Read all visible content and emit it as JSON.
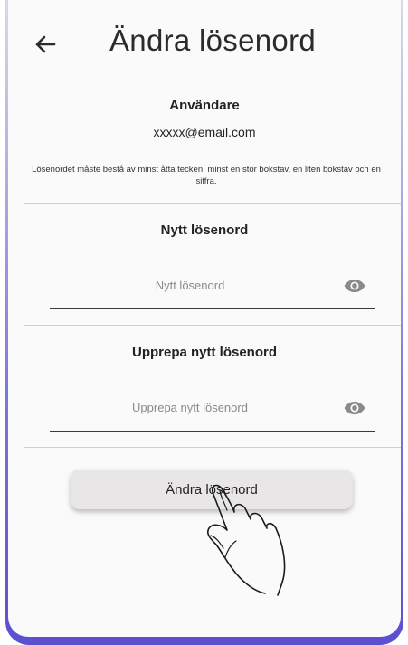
{
  "header": {
    "back_icon": "arrow-left-icon",
    "title": "Ändra lösenord"
  },
  "user": {
    "label": "Användare",
    "email": "xxxxx@email.com"
  },
  "requirements_text": "Lösenordet måste bestå av minst åtta tecken, minst en stor bokstav, en liten bokstav och en siffra.",
  "new_password": {
    "label": "Nytt lösenord",
    "placeholder": "Nytt lösenord",
    "value": "",
    "toggle_icon": "eye-icon"
  },
  "repeat_password": {
    "label": "Upprepa nytt lösenord",
    "placeholder": "Upprepa nytt lösenord",
    "value": "",
    "toggle_icon": "eye-icon"
  },
  "submit": {
    "label": "Ändra lösenord"
  },
  "colors": {
    "text": "#222222",
    "divider": "#cfcfcf",
    "button_bg": "#e8e6e6",
    "eye_icon": "#8a8a8a",
    "frame_accent": "#5b4fd0"
  }
}
